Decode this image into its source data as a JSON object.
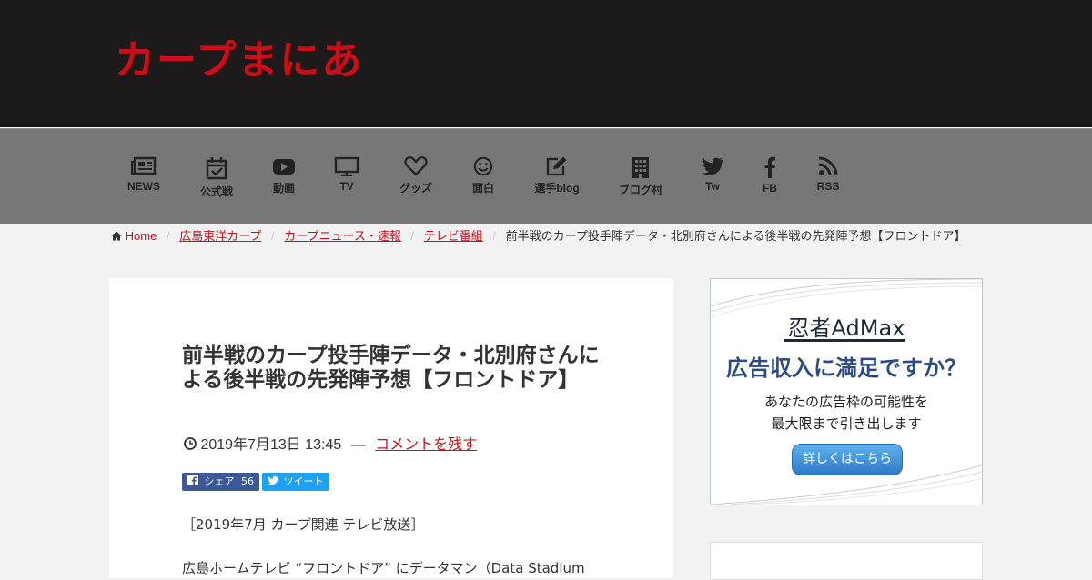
{
  "site": {
    "logo": "カープまにあ"
  },
  "nav": [
    {
      "label": "NEWS",
      "icon": "newspaper-icon"
    },
    {
      "label": "公式戦",
      "icon": "calendar-check-icon"
    },
    {
      "label": "動画",
      "icon": "youtube-icon"
    },
    {
      "label": "TV",
      "icon": "tv-icon"
    },
    {
      "label": "グッズ",
      "icon": "heart-icon"
    },
    {
      "label": "面白",
      "icon": "smile-icon"
    },
    {
      "label": "選手blog",
      "icon": "edit-icon"
    },
    {
      "label": "ブログ村",
      "icon": "building-icon"
    },
    {
      "label": "Tw",
      "icon": "twitter-icon"
    },
    {
      "label": "FB",
      "icon": "facebook-icon"
    },
    {
      "label": "RSS",
      "icon": "rss-icon"
    }
  ],
  "breadcrumb": {
    "home": "Home",
    "items": [
      "広島東洋カープ",
      "カープニュース・速報",
      "テレビ番組"
    ],
    "current": "前半戦のカープ投手陣データ・北別府さんによる後半戦の先発陣予想【フロントドア】"
  },
  "article": {
    "title": "前半戦のカープ投手陣データ・北別府さんによる後半戦の先発陣予想【フロントドア】",
    "date": "2019年7月13日 13:45",
    "dash": "—",
    "comment_link": "コメントを残す",
    "share_fb": "シェア",
    "share_fb_count": "56",
    "share_tw": "ツイート",
    "para1": "［2019年7月 カープ関連 テレビ放送］",
    "para2": "広島ホームテレビ “フロントドア” にデータマン（Data Stadium"
  },
  "ad": {
    "brand": "忍者AdMax",
    "headline": "広告収入に満足ですか？",
    "line1": "あなたの広告枠の可能性を",
    "line2": "最大限まで引き出します",
    "button": "詳しくはこちら"
  },
  "colors": {
    "accent": "#c8101a",
    "header_bg": "#1c1a1b",
    "nav_bg": "#777777"
  }
}
